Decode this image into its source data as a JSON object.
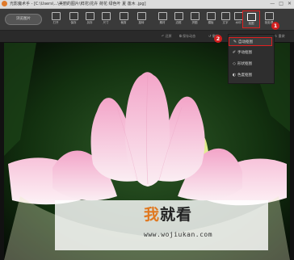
{
  "window": {
    "title": "光影魔术手 - [C:\\Users\\...\\美丽的图片\\鲜花\\花卉 荷花 绿色叶 夏 莲木 .jpg]",
    "controls": [
      "—",
      "□",
      "✕"
    ]
  },
  "toolbar": {
    "open_label": "浏览图片",
    "tools": [
      {
        "label": "打开",
        "icon": "open-icon"
      },
      {
        "label": "保存",
        "icon": "save-icon"
      },
      {
        "label": "另存",
        "icon": "save-as-icon"
      },
      {
        "label": "尺寸",
        "icon": "resize-icon",
        "dropdown": true
      },
      {
        "label": "裁剪",
        "icon": "crop-icon",
        "dropdown": true
      },
      {
        "label": "旋转",
        "icon": "rotate-icon",
        "dropdown": true
      },
      {
        "label": "素材",
        "icon": "material-icon"
      },
      {
        "label": "边框",
        "icon": "frame-icon"
      },
      {
        "label": "拼图",
        "icon": "collage-icon"
      },
      {
        "label": "模板",
        "icon": "template-icon"
      },
      {
        "label": "文字",
        "icon": "text-icon"
      },
      {
        "label": "水印",
        "icon": "watermark-icon"
      },
      {
        "label": "抠图",
        "icon": "cutout-icon",
        "active": true
      },
      {
        "label": "批处理",
        "icon": "batch-icon",
        "dropdown": true
      }
    ]
  },
  "secondbar": {
    "items": [
      "↶ 还原",
      "⧉ 保存动态",
      "↺ 撤销",
      "↻ 重做"
    ]
  },
  "cutout_menu": {
    "items": [
      {
        "label": "自动抠图",
        "icon": "magic-wand-icon",
        "highlight": true
      },
      {
        "label": "手动抠图",
        "icon": "brush-icon"
      },
      {
        "label": "形状抠图",
        "icon": "shape-icon"
      },
      {
        "label": "色度抠图",
        "icon": "chroma-icon"
      }
    ]
  },
  "badges": [
    "1",
    "2"
  ],
  "watermark": {
    "logo_part1": "我",
    "logo_part2": "就看",
    "url": "www.wojiukan.com"
  },
  "colors": {
    "accent_red": "#e02020",
    "toolbar_bg": "#3a3a3a",
    "watermark_orange": "#e07820"
  }
}
